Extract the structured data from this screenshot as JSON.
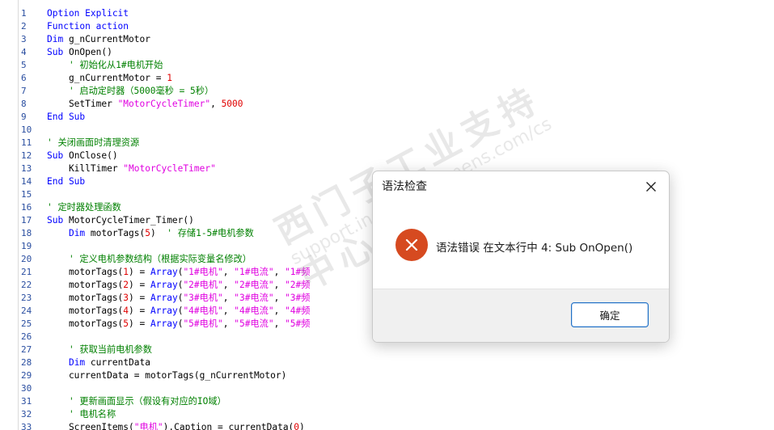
{
  "editor": {
    "lines": [
      {
        "n": "1",
        "parts": [
          {
            "t": "Option Explicit",
            "c": "kw"
          }
        ]
      },
      {
        "n": "2",
        "parts": [
          {
            "t": "Function action",
            "c": "kw"
          }
        ]
      },
      {
        "n": "3",
        "parts": [
          {
            "t": "Dim ",
            "c": "kw"
          },
          {
            "t": "g_nCurrentMotor",
            "c": "tx"
          }
        ]
      },
      {
        "n": "4",
        "parts": [
          {
            "t": "Sub ",
            "c": "kw"
          },
          {
            "t": "OnOpen()",
            "c": "tx"
          }
        ]
      },
      {
        "n": "5",
        "parts": [
          {
            "t": "    ' 初始化从1#电机开始",
            "c": "cm"
          }
        ]
      },
      {
        "n": "6",
        "parts": [
          {
            "t": "    g_nCurrentMotor = ",
            "c": "tx"
          },
          {
            "t": "1",
            "c": "nm"
          }
        ]
      },
      {
        "n": "7",
        "parts": [
          {
            "t": "    ' 启动定时器（5000毫秒 = 5秒）",
            "c": "cm"
          }
        ]
      },
      {
        "n": "8",
        "parts": [
          {
            "t": "    SetTimer ",
            "c": "tx"
          },
          {
            "t": "\"MotorCycleTimer\"",
            "c": "st"
          },
          {
            "t": ", ",
            "c": "tx"
          },
          {
            "t": "5000",
            "c": "nm"
          }
        ]
      },
      {
        "n": "9",
        "parts": [
          {
            "t": "End Sub",
            "c": "kw"
          }
        ]
      },
      {
        "n": "10",
        "parts": []
      },
      {
        "n": "11",
        "parts": [
          {
            "t": "' 关闭画面时清理资源",
            "c": "cm"
          }
        ]
      },
      {
        "n": "12",
        "parts": [
          {
            "t": "Sub ",
            "c": "kw"
          },
          {
            "t": "OnClose()",
            "c": "tx"
          }
        ]
      },
      {
        "n": "13",
        "parts": [
          {
            "t": "    KillTimer ",
            "c": "tx"
          },
          {
            "t": "\"MotorCycleTimer\"",
            "c": "st"
          }
        ]
      },
      {
        "n": "14",
        "parts": [
          {
            "t": "End Sub",
            "c": "kw"
          }
        ]
      },
      {
        "n": "15",
        "parts": []
      },
      {
        "n": "16",
        "parts": [
          {
            "t": "' 定时器处理函数",
            "c": "cm"
          }
        ]
      },
      {
        "n": "17",
        "parts": [
          {
            "t": "Sub ",
            "c": "kw"
          },
          {
            "t": "MotorCycleTimer_Timer()",
            "c": "tx"
          }
        ]
      },
      {
        "n": "18",
        "parts": [
          {
            "t": "    ",
            "c": "tx"
          },
          {
            "t": "Dim ",
            "c": "kw"
          },
          {
            "t": "motorTags(",
            "c": "tx"
          },
          {
            "t": "5",
            "c": "nm"
          },
          {
            "t": ")  ",
            "c": "tx"
          },
          {
            "t": "' 存储1-5#电机参数",
            "c": "cm"
          }
        ]
      },
      {
        "n": "19",
        "parts": []
      },
      {
        "n": "20",
        "parts": [
          {
            "t": "    ' 定义电机参数结构（根据实际变量名修改）",
            "c": "cm"
          }
        ]
      },
      {
        "n": "21",
        "parts": [
          {
            "t": "    motorTags(",
            "c": "tx"
          },
          {
            "t": "1",
            "c": "nm"
          },
          {
            "t": ") = ",
            "c": "tx"
          },
          {
            "t": "Array",
            "c": "kw"
          },
          {
            "t": "(",
            "c": "tx"
          },
          {
            "t": "\"1#电机\"",
            "c": "st"
          },
          {
            "t": ", ",
            "c": "tx"
          },
          {
            "t": "\"1#电流\"",
            "c": "st"
          },
          {
            "t": ", ",
            "c": "tx"
          },
          {
            "t": "\"1#频",
            "c": "st"
          }
        ]
      },
      {
        "n": "22",
        "parts": [
          {
            "t": "    motorTags(",
            "c": "tx"
          },
          {
            "t": "2",
            "c": "nm"
          },
          {
            "t": ") = ",
            "c": "tx"
          },
          {
            "t": "Array",
            "c": "kw"
          },
          {
            "t": "(",
            "c": "tx"
          },
          {
            "t": "\"2#电机\"",
            "c": "st"
          },
          {
            "t": ", ",
            "c": "tx"
          },
          {
            "t": "\"2#电流\"",
            "c": "st"
          },
          {
            "t": ", ",
            "c": "tx"
          },
          {
            "t": "\"2#频",
            "c": "st"
          }
        ]
      },
      {
        "n": "23",
        "parts": [
          {
            "t": "    motorTags(",
            "c": "tx"
          },
          {
            "t": "3",
            "c": "nm"
          },
          {
            "t": ") = ",
            "c": "tx"
          },
          {
            "t": "Array",
            "c": "kw"
          },
          {
            "t": "(",
            "c": "tx"
          },
          {
            "t": "\"3#电机\"",
            "c": "st"
          },
          {
            "t": ", ",
            "c": "tx"
          },
          {
            "t": "\"3#电流\"",
            "c": "st"
          },
          {
            "t": ", ",
            "c": "tx"
          },
          {
            "t": "\"3#频",
            "c": "st"
          }
        ]
      },
      {
        "n": "24",
        "parts": [
          {
            "t": "    motorTags(",
            "c": "tx"
          },
          {
            "t": "4",
            "c": "nm"
          },
          {
            "t": ") = ",
            "c": "tx"
          },
          {
            "t": "Array",
            "c": "kw"
          },
          {
            "t": "(",
            "c": "tx"
          },
          {
            "t": "\"4#电机\"",
            "c": "st"
          },
          {
            "t": ", ",
            "c": "tx"
          },
          {
            "t": "\"4#电流\"",
            "c": "st"
          },
          {
            "t": ", ",
            "c": "tx"
          },
          {
            "t": "\"4#频",
            "c": "st"
          }
        ]
      },
      {
        "n": "25",
        "parts": [
          {
            "t": "    motorTags(",
            "c": "tx"
          },
          {
            "t": "5",
            "c": "nm"
          },
          {
            "t": ") = ",
            "c": "tx"
          },
          {
            "t": "Array",
            "c": "kw"
          },
          {
            "t": "(",
            "c": "tx"
          },
          {
            "t": "\"5#电机\"",
            "c": "st"
          },
          {
            "t": ", ",
            "c": "tx"
          },
          {
            "t": "\"5#电流\"",
            "c": "st"
          },
          {
            "t": ", ",
            "c": "tx"
          },
          {
            "t": "\"5#频",
            "c": "st"
          }
        ]
      },
      {
        "n": "26",
        "parts": []
      },
      {
        "n": "27",
        "parts": [
          {
            "t": "    ' 获取当前电机参数",
            "c": "cm"
          }
        ]
      },
      {
        "n": "28",
        "parts": [
          {
            "t": "    ",
            "c": "tx"
          },
          {
            "t": "Dim ",
            "c": "kw"
          },
          {
            "t": "currentData",
            "c": "tx"
          }
        ]
      },
      {
        "n": "29",
        "parts": [
          {
            "t": "    currentData = motorTags(g_nCurrentMotor)",
            "c": "tx"
          }
        ]
      },
      {
        "n": "30",
        "parts": []
      },
      {
        "n": "31",
        "parts": [
          {
            "t": "    ' 更新画面显示（假设有对应的IO域）",
            "c": "cm"
          }
        ]
      },
      {
        "n": "32",
        "parts": [
          {
            "t": "    ' 电机名称",
            "c": "cm"
          }
        ]
      },
      {
        "n": "33",
        "parts": [
          {
            "t": "    ScreenItems(",
            "c": "tx"
          },
          {
            "t": "\"电机\"",
            "c": "st"
          },
          {
            "t": ").Caption = currentData(",
            "c": "tx"
          },
          {
            "t": "0",
            "c": "nm"
          },
          {
            "t": ")",
            "c": "tx"
          }
        ]
      }
    ]
  },
  "dialog": {
    "title": "语法检查",
    "message": "语法错误 在文本行中 4: Sub OnOpen()",
    "ok_label": "确定",
    "icon": "error-icon",
    "close_icon": "close-icon"
  },
  "watermark": {
    "text1": "西门子工业支持中心",
    "text2": "support.industry.siemens.com/cs"
  },
  "colors": {
    "keyword": "#0000ff",
    "comment": "#008000",
    "string": "#e000e0",
    "number": "#e00000",
    "error_icon": "#d64a20",
    "button_border": "#1f6fc5"
  }
}
